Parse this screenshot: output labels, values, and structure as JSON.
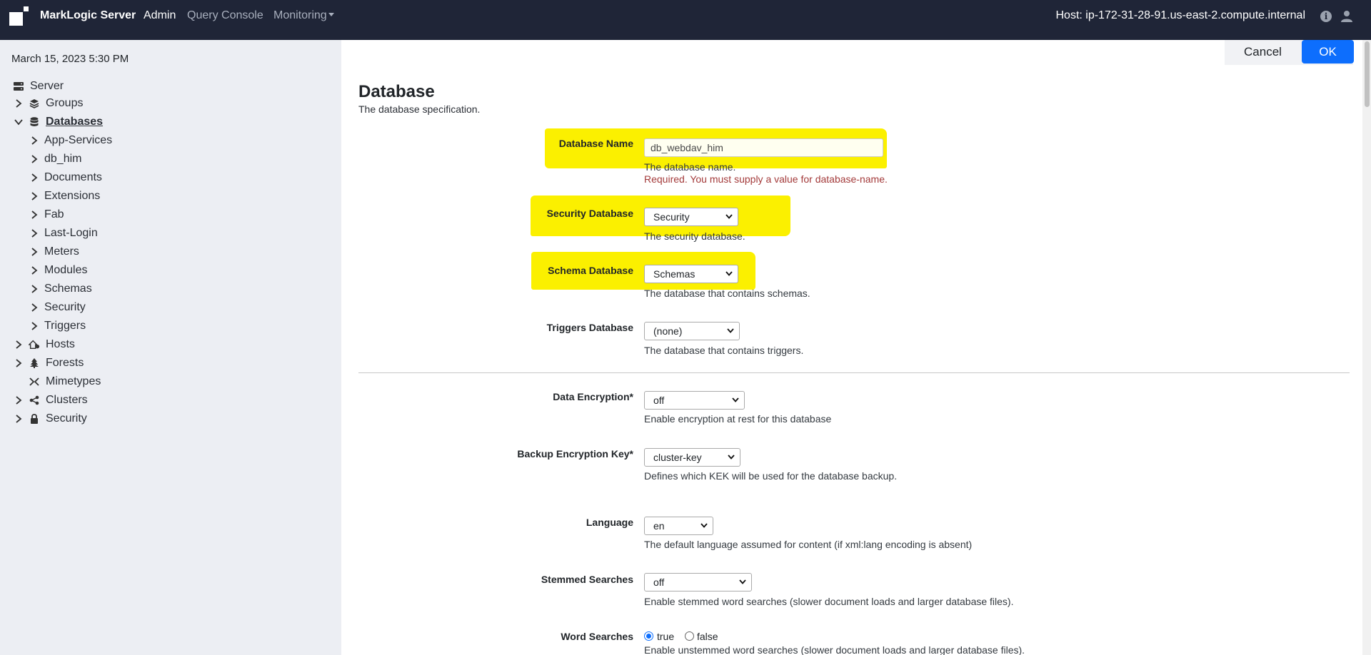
{
  "nav": {
    "brand": "MarkLogic Server",
    "admin": "Admin",
    "query_console": "Query Console",
    "monitoring": "Monitoring",
    "host": "Host: ip-172-31-28-91.us-east-2.compute.internal",
    "info_icon": "i"
  },
  "sidebar": {
    "date": "March 15, 2023 5:30 PM",
    "server": "Server",
    "groups": "Groups",
    "databases": "Databases",
    "db_items": [
      "App-Services",
      "db_him",
      "Documents",
      "Extensions",
      "Fab",
      "Last-Login",
      "Meters",
      "Modules",
      "Schemas",
      "Security",
      "Triggers"
    ],
    "hosts": "Hosts",
    "forests": "Forests",
    "mimetypes": "Mimetypes",
    "clusters": "Clusters",
    "security": "Security"
  },
  "actions": {
    "cancel": "Cancel",
    "ok": "OK"
  },
  "page": {
    "title": "Database",
    "subtitle": "The database specification."
  },
  "fields": {
    "database_name": {
      "label": "Database Name",
      "value": "db_webdav_him",
      "desc": "The database name.",
      "error": "Required. You must supply a value for database-name."
    },
    "security_database": {
      "label": "Security Database",
      "value": "Security",
      "desc": "The security database."
    },
    "schema_database": {
      "label": "Schema Database",
      "value": "Schemas",
      "desc": "The database that contains schemas."
    },
    "triggers_database": {
      "label": "Triggers Database",
      "value": "(none)",
      "desc": "The database that contains triggers."
    },
    "data_encryption": {
      "label": "Data Encryption*",
      "value": "off",
      "desc": "Enable encryption at rest for this database"
    },
    "backup_encryption_key": {
      "label": "Backup Encryption Key*",
      "value": "cluster-key",
      "desc": "Defines which KEK will be used for the database backup."
    },
    "language": {
      "label": "Language",
      "value": "en",
      "desc": "The default language assumed for content (if xml:lang encoding is absent)"
    },
    "stemmed_searches": {
      "label": "Stemmed Searches",
      "value": "off",
      "desc": "Enable stemmed word searches (slower document loads and larger database files)."
    },
    "word_searches": {
      "label": "Word Searches",
      "true_label": "true",
      "false_label": "false",
      "selected": "true",
      "desc": "Enable unstemmed word searches (slower document loads and larger database files)."
    }
  },
  "colors": {
    "navbar": "#1f2537",
    "sidebar": "#eceef3",
    "highlight": "#fbf000",
    "primary": "#0d6efd",
    "error": "#a33a3a"
  }
}
